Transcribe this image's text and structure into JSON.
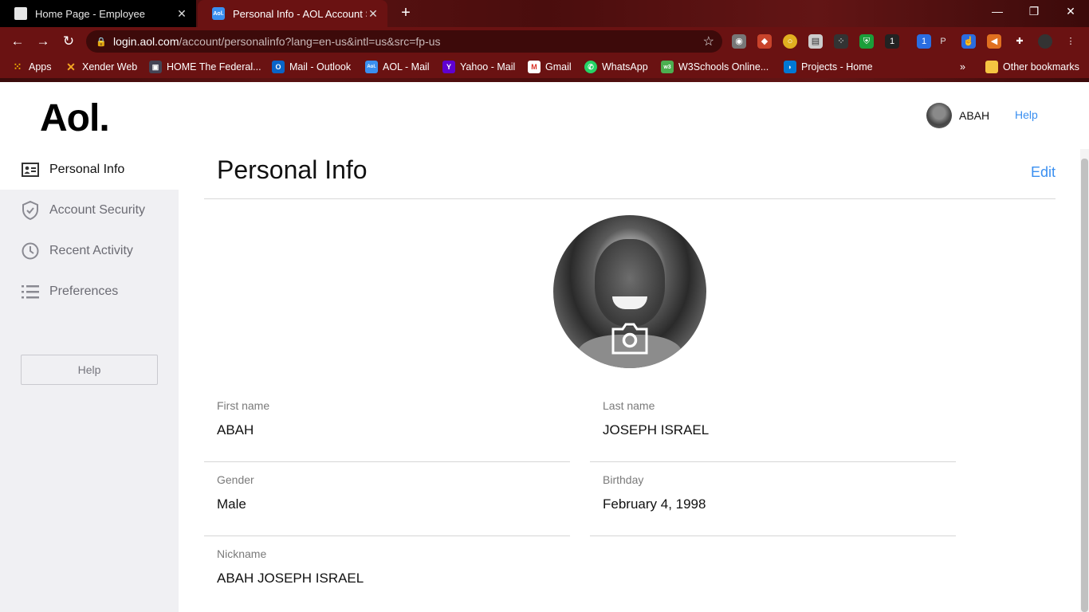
{
  "browser": {
    "tabs": [
      {
        "title": "Home Page - Employee",
        "active": false
      },
      {
        "title": "Personal Info - AOL Account Sett",
        "active": true
      }
    ],
    "url_host": "login.aol.com",
    "url_path": "/account/personalinfo?lang=en-us&intl=us&src=fp-us",
    "bookmarks": [
      "Apps",
      "Xender Web",
      "HOME  The Federal...",
      "Mail - Outlook",
      "AOL - Mail",
      "Yahoo - Mail",
      "Gmail",
      "WhatsApp",
      "W3Schools Online...",
      "Projects - Home"
    ],
    "other_bookmarks": "Other bookmarks",
    "more_bookmarks": "»"
  },
  "header": {
    "logo": "Aol.",
    "username": "ABAH",
    "help": "Help"
  },
  "sidebar": {
    "items": [
      {
        "label": "Personal Info",
        "icon": "id-card-icon",
        "active": true
      },
      {
        "label": "Account Security",
        "icon": "shield-check-icon",
        "active": false
      },
      {
        "label": "Recent Activity",
        "icon": "clock-icon",
        "active": false
      },
      {
        "label": "Preferences",
        "icon": "list-icon",
        "active": false
      }
    ],
    "help_button": "Help"
  },
  "main": {
    "title": "Personal Info",
    "edit": "Edit",
    "fields": [
      {
        "label": "First name",
        "value": "ABAH"
      },
      {
        "label": "Last name",
        "value": "JOSEPH ISRAEL"
      },
      {
        "label": "Gender",
        "value": "Male"
      },
      {
        "label": "Birthday",
        "value": "February 4, 1998"
      },
      {
        "label": "Nickname",
        "value": "ABAH JOSEPH ISRAEL"
      }
    ]
  },
  "colors": {
    "accent": "#3a8ff0",
    "chrome": "#6a1212",
    "sidebar": "#f0f0f3"
  }
}
